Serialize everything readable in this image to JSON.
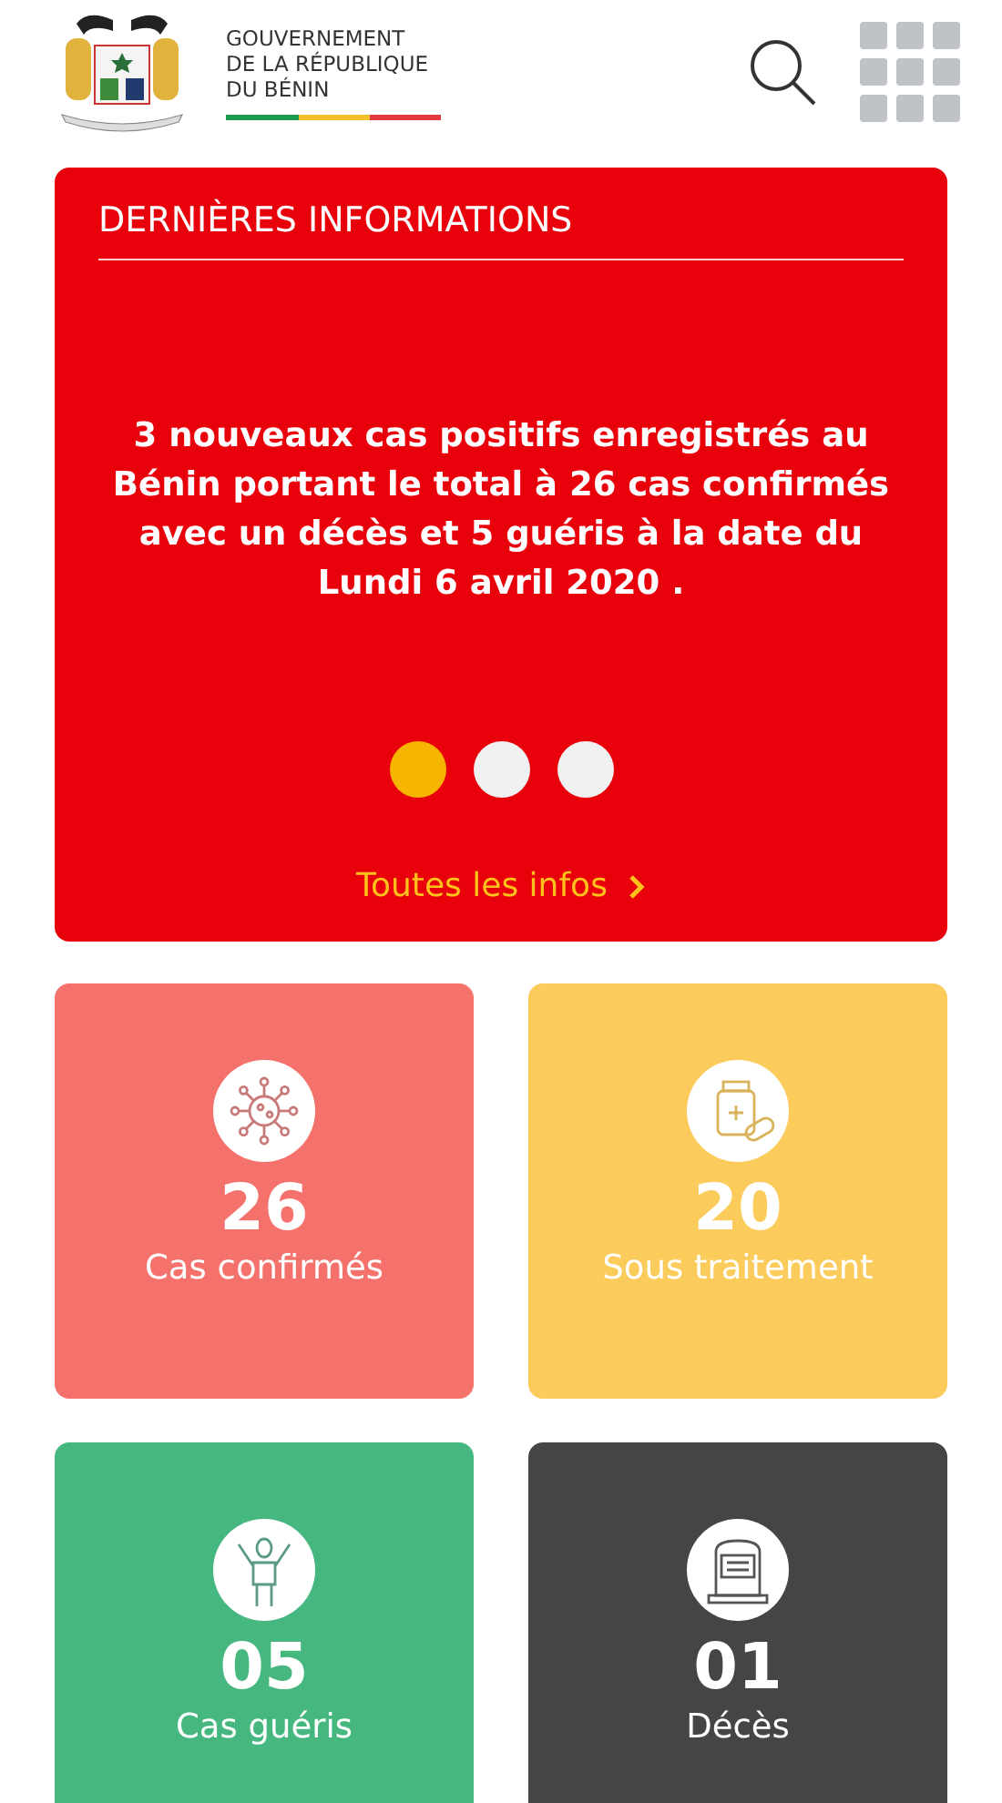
{
  "header": {
    "title_lines": [
      "GOUVERNEMENT",
      "DE LA RÉPUBLIQUE",
      "DU BÉNIN"
    ]
  },
  "news": {
    "heading": "DERNIÈRES INFORMATIONS",
    "message": "3 nouveaux cas positifs enregistrés au Bénin portant le total à 26 cas confirmés avec un décès et 5 guéris à la date du Lundi 6 avril 2020 .",
    "pages": [
      {
        "selected": true
      },
      {
        "selected": false
      },
      {
        "selected": false
      }
    ],
    "link": "Toutes les infos"
  },
  "stats": [
    {
      "kind": "virus",
      "color": "#f4716c",
      "value": "26",
      "label": "Cas confirmés"
    },
    {
      "kind": "medicine",
      "color": "#fbcb5c",
      "value": "20",
      "label": "Sous traitement"
    },
    {
      "kind": "recovered",
      "color": "#45b77f",
      "value": "05",
      "label": "Cas guéris"
    },
    {
      "kind": "death",
      "color": "#454545",
      "value": "01",
      "label": "Décès"
    }
  ]
}
